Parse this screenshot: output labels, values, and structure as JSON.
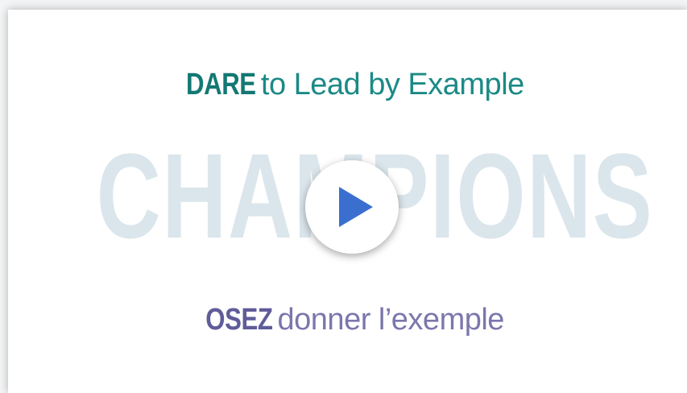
{
  "slide": {
    "top_line": {
      "emphasis": "DARE",
      "rest": "to Lead by Example"
    },
    "watermark": "CHAMPIONS",
    "bottom_line": {
      "emphasis": "OSEZ",
      "rest": "donner l’exemple"
    }
  },
  "player": {
    "play_icon": "play-icon",
    "accent_color": "#3a6fd0"
  },
  "colors": {
    "teal": "#1b8a86",
    "purple": "#7a77ad",
    "watermark": "#dbe6ec"
  }
}
